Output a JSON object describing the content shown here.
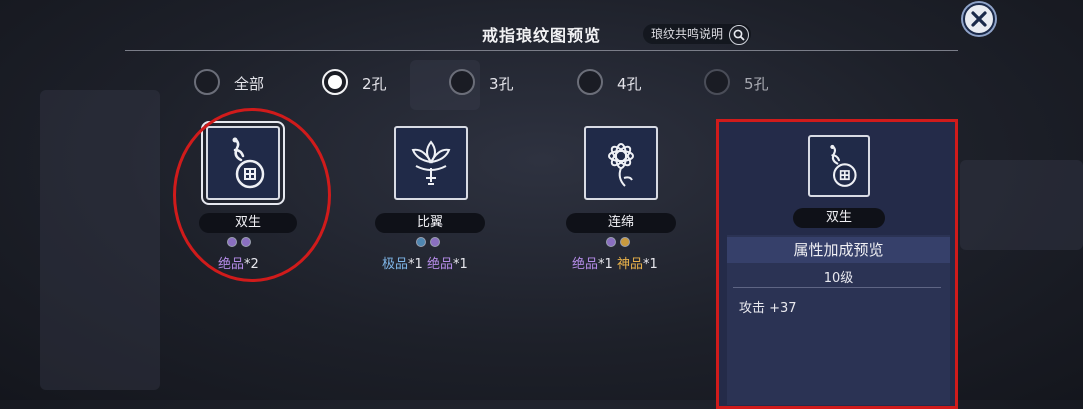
{
  "header": {
    "title": "戒指琅纹图预览",
    "help_label": "琅纹共鸣说明"
  },
  "filters": [
    {
      "label": "全部",
      "selected": false
    },
    {
      "label": "2孔",
      "selected": true
    },
    {
      "label": "3孔",
      "selected": false
    },
    {
      "label": "4孔",
      "selected": false
    },
    {
      "label": "5孔",
      "selected": false
    }
  ],
  "patterns": [
    {
      "name": "双生",
      "emblem": "gourd-emblem-icon",
      "gems": [
        "#8a6fc0",
        "#8a6fc0"
      ],
      "qualities": [
        {
          "label": "绝品",
          "count": "*2",
          "color": "#b58ce8"
        }
      ]
    },
    {
      "name": "比翼",
      "emblem": "lotus-emblem-icon",
      "gems": [
        "#4f86b0",
        "#8a6fc0"
      ],
      "qualities": [
        {
          "label": "极品",
          "count": "*1",
          "color": "#7fb6e8"
        },
        {
          "label": "绝品",
          "count": "*1",
          "color": "#b58ce8"
        }
      ]
    },
    {
      "name": "连绵",
      "emblem": "flower-emblem-icon",
      "gems": [
        "#8a6fc0",
        "#c99a3e"
      ],
      "qualities": [
        {
          "label": "绝品",
          "count": "*1",
          "color": "#b58ce8"
        },
        {
          "label": "神品",
          "count": "*1",
          "color": "#e8b14a"
        }
      ]
    }
  ],
  "preview": {
    "name": "双生",
    "emblem": "gourd-emblem-icon",
    "section_title": "属性加成预览",
    "level": "10级",
    "stat": "攻击 +37"
  },
  "colors": {
    "highlight_red": "#d01b1b",
    "panel_bg": "#242b49"
  }
}
